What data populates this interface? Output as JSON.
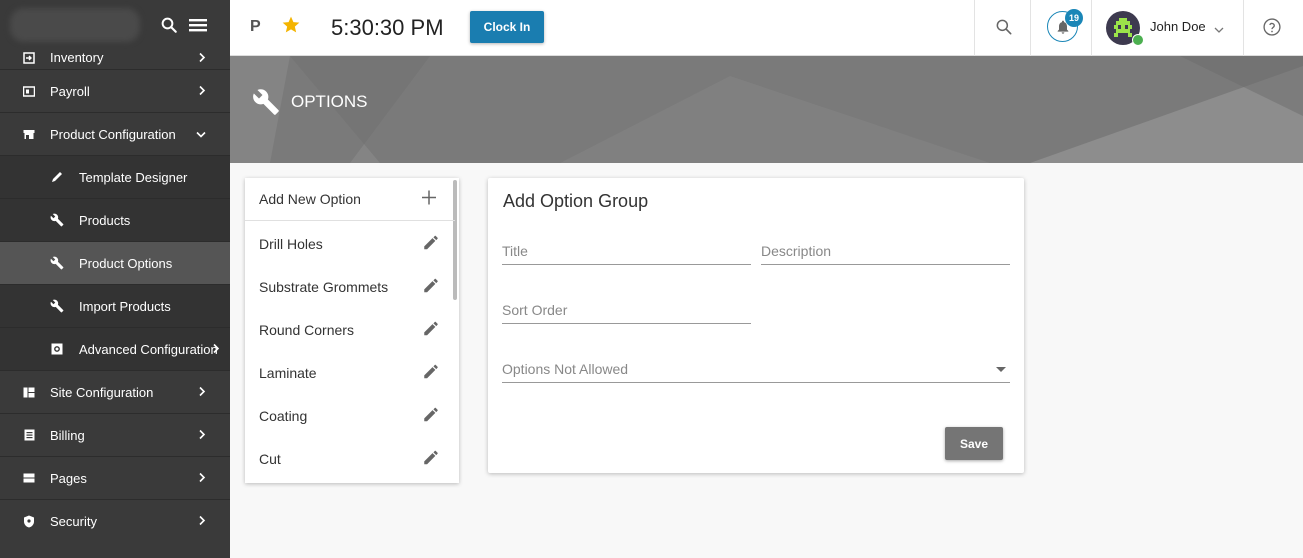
{
  "sidebar": {
    "items": [
      {
        "label": "Inventory",
        "icon": "login-box-icon",
        "chevron": "right"
      },
      {
        "label": "Payroll",
        "icon": "id-card-icon",
        "chevron": "right"
      },
      {
        "label": "Product Configuration",
        "icon": "store-icon",
        "chevron": "down"
      },
      {
        "label": "Template Designer",
        "icon": "pencil-icon",
        "sub": true
      },
      {
        "label": "Products",
        "icon": "wrench-icon",
        "sub": true
      },
      {
        "label": "Product Options",
        "icon": "wrench-icon",
        "sub": true,
        "active": true
      },
      {
        "label": "Import Products",
        "icon": "wrench-icon",
        "sub": true
      },
      {
        "label": "Advanced Configuration",
        "icon": "cog-box-icon",
        "sub": true,
        "chevron": "right"
      },
      {
        "label": "Site Configuration",
        "icon": "view-quilt-icon",
        "chevron": "right"
      },
      {
        "label": "Billing",
        "icon": "receipt-icon",
        "chevron": "right"
      },
      {
        "label": "Pages",
        "icon": "pages-icon",
        "chevron": "right"
      },
      {
        "label": "Security",
        "icon": "shield-icon",
        "chevron": "right"
      }
    ]
  },
  "topbar": {
    "letter": "P",
    "time": "5:30:30 PM",
    "clock_in_label": "Clock In",
    "notification_count": "19",
    "user_name": "John Doe"
  },
  "banner": {
    "title": "OPTIONS"
  },
  "options_list": {
    "add_label": "Add New Option",
    "items": [
      "Drill Holes",
      "Substrate Grommets",
      "Round Corners",
      "Laminate",
      "Coating",
      "Cut"
    ]
  },
  "form": {
    "title": "Add Option Group",
    "title_placeholder": "Title",
    "description_placeholder": "Description",
    "sort_order_placeholder": "Sort Order",
    "options_not_allowed_label": "Options Not Allowed",
    "save_label": "Save"
  },
  "colors": {
    "sidebar_bg": "#3a3a3a",
    "accent_blue": "#1a7db0",
    "star": "#f4b400",
    "banner_bg": "#7c7c7c"
  }
}
